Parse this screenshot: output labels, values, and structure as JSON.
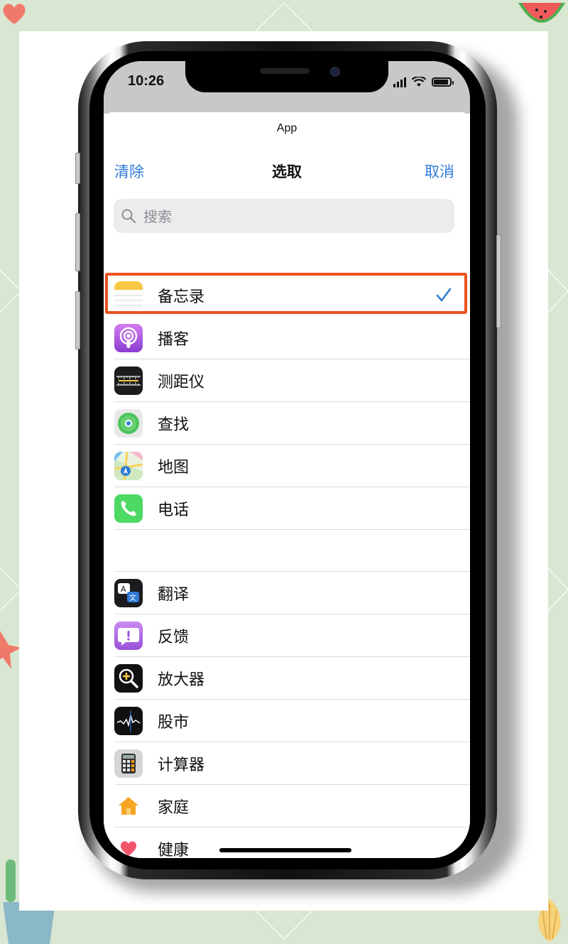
{
  "status_bar": {
    "time": "10:26"
  },
  "sheet": {
    "title": "App",
    "nav": {
      "left": "清除",
      "title": "选取",
      "right": "取消"
    },
    "search": {
      "placeholder": "搜索"
    }
  },
  "apps_group1": [
    {
      "label": "备忘录",
      "icon": "notes-icon",
      "selected": true
    },
    {
      "label": "播客",
      "icon": "podcasts-icon",
      "selected": false
    },
    {
      "label": "测距仪",
      "icon": "measure-icon",
      "selected": false
    },
    {
      "label": "查找",
      "icon": "find-my-icon",
      "selected": false
    },
    {
      "label": "地图",
      "icon": "maps-icon",
      "selected": false
    },
    {
      "label": "电话",
      "icon": "phone-icon",
      "selected": false
    }
  ],
  "apps_group2": [
    {
      "label": "翻译",
      "icon": "translate-icon"
    },
    {
      "label": "反馈",
      "icon": "feedback-icon"
    },
    {
      "label": "放大器",
      "icon": "magnifier-icon"
    },
    {
      "label": "股市",
      "icon": "stocks-icon"
    },
    {
      "label": "计算器",
      "icon": "calculator-icon"
    },
    {
      "label": "家庭",
      "icon": "home-icon"
    },
    {
      "label": "健康",
      "icon": "health-icon"
    }
  ],
  "colors": {
    "accent": "#2f7bd8",
    "highlight": "#e8521d",
    "background": "#d9e6d1"
  }
}
